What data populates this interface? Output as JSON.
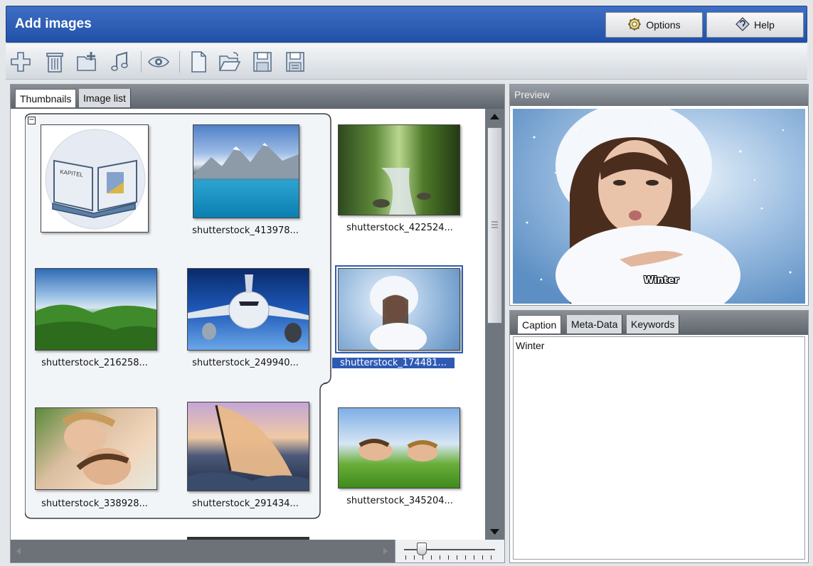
{
  "window": {
    "title": "Add images"
  },
  "header_buttons": {
    "options": "Options",
    "help": "Help"
  },
  "toolbar": {
    "icons": [
      "add-icon",
      "delete-icon",
      "add-folder-icon",
      "music-icon",
      "preview-eye-icon",
      "new-document-icon",
      "open-folder-icon",
      "save-icon",
      "save-as-icon"
    ]
  },
  "left_tabs": {
    "thumbnails": "Thumbnails",
    "image_list": "Image list"
  },
  "thumbnails": [
    {
      "label": "",
      "kind": "book"
    },
    {
      "label": "shutterstock_413978...",
      "kind": "lake"
    },
    {
      "label": "shutterstock_422524...",
      "kind": "forest"
    },
    {
      "label": "shutterstock_216258...",
      "kind": "hills"
    },
    {
      "label": "shutterstock_249940...",
      "kind": "plane"
    },
    {
      "label": "shutterstock_174481...",
      "kind": "winter",
      "selected": true
    },
    {
      "label": "shutterstock_338928...",
      "kind": "couple"
    },
    {
      "label": "shutterstock_291434...",
      "kind": "sail"
    },
    {
      "label": "shutterstock_345204...",
      "kind": "grass"
    }
  ],
  "book_icon_text": "KAPITEL",
  "preview": {
    "heading": "Preview",
    "overlay_caption": "Winter"
  },
  "info_tabs": {
    "caption": "Caption",
    "meta": "Meta-Data",
    "keywords": "Keywords"
  },
  "caption_text": "Winter",
  "colors": {
    "title_bar": "#2f5cb5",
    "selection": "#2f5ab4",
    "panel_header": "#6f757c"
  }
}
